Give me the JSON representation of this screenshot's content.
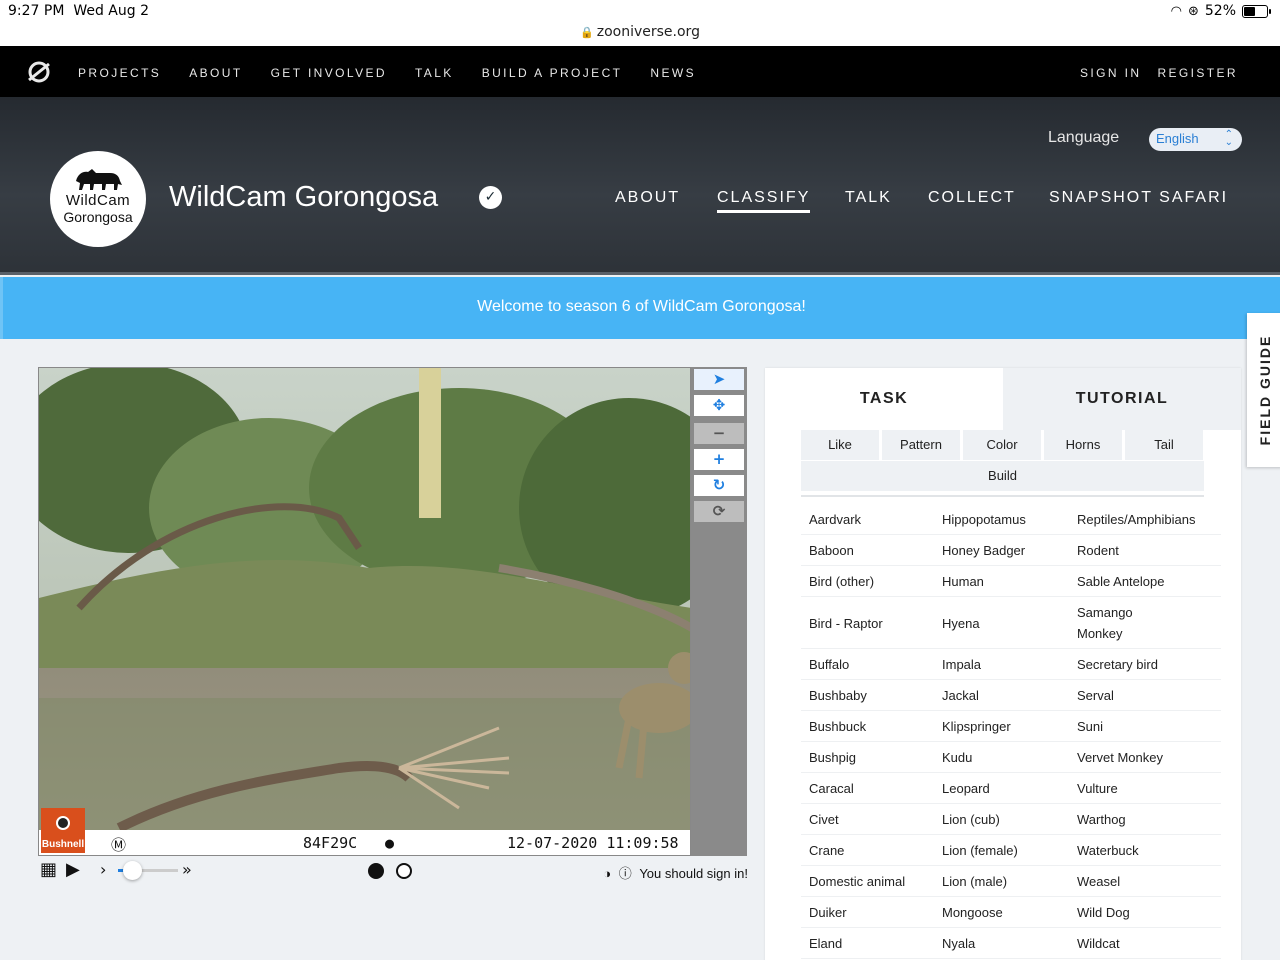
{
  "status_bar": {
    "time": "9:27 PM",
    "date": "Wed Aug 2",
    "url": "zooniverse.org",
    "battery": "52%",
    "battery_level": 0.52
  },
  "top_nav": {
    "items": [
      "PROJECTS",
      "ABOUT",
      "GET INVOLVED",
      "TALK",
      "BUILD A PROJECT",
      "NEWS"
    ],
    "sign_in": "SIGN IN",
    "register": "REGISTER"
  },
  "project": {
    "language_label": "Language",
    "language_value": "English",
    "logo_line1": "WildCam",
    "logo_line2": "Gorongosa",
    "title": "WildCam Gorongosa",
    "nav": [
      "ABOUT",
      "CLASSIFY",
      "TALK",
      "COLLECT",
      "SNAPSHOT SAFARI"
    ],
    "active_nav": "CLASSIFY"
  },
  "banner": {
    "text": "Welcome to season 6 of WildCam Gorongosa!"
  },
  "field_guide": "FIELD GUIDE",
  "viewer": {
    "camera_brand": "Bushnell",
    "overlay_mark": "Ⓜ",
    "camera_id": "84F29C",
    "datetime": "12-07-2020  11:09:58",
    "signin_notice": "You should sign in!"
  },
  "task_panel": {
    "tabs": [
      "TASK",
      "TUTORIAL"
    ],
    "filters": [
      "Like",
      "Pattern",
      "Color",
      "Horns",
      "Tail",
      "Build"
    ],
    "species_rows": [
      [
        "Aardvark",
        "Hippopotamus",
        "Reptiles/Amphibians"
      ],
      [
        "Baboon",
        "Honey Badger",
        "Rodent"
      ],
      [
        "Bird (other)",
        "Human",
        "Sable Antelope"
      ],
      [
        "Bird - Raptor",
        "Hyena",
        "Samango Monkey"
      ],
      [
        "Buffalo",
        "Impala",
        "Secretary bird"
      ],
      [
        "Bushbaby",
        "Jackal",
        "Serval"
      ],
      [
        "Bushbuck",
        "Klipspringer",
        "Suni"
      ],
      [
        "Bushpig",
        "Kudu",
        "Vervet Monkey"
      ],
      [
        "Caracal",
        "Leopard",
        "Vulture"
      ],
      [
        "Civet",
        "Lion (cub)",
        "Warthog"
      ],
      [
        "Crane",
        "Lion (female)",
        "Waterbuck"
      ],
      [
        "Domestic animal",
        "Lion (male)",
        "Weasel"
      ],
      [
        "Duiker",
        "Mongoose",
        "Wild Dog"
      ],
      [
        "Eland",
        "Nyala",
        "Wildcat"
      ]
    ]
  },
  "colors": {
    "banner": "#47b4f5",
    "accent": "#1f7fe0",
    "nav_bg": "#000000"
  }
}
